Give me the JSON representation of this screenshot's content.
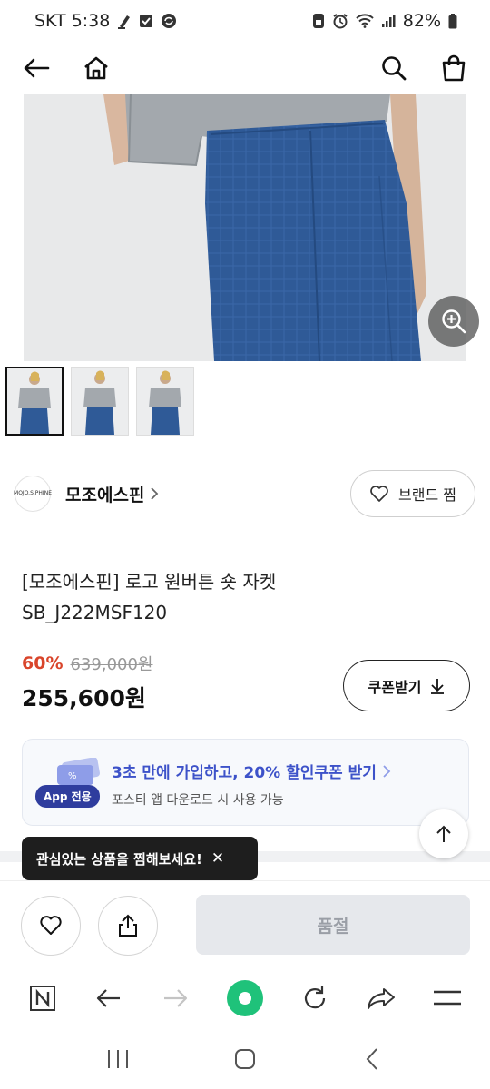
{
  "status_bar": {
    "carrier_time": "SKT 5:38",
    "battery": "82%"
  },
  "header": {
    "icons": [
      "back-arrow-icon",
      "home-icon",
      "search-icon",
      "shopping-bag-icon"
    ]
  },
  "gallery": {
    "thumbnail_count": 3,
    "active_index": 0
  },
  "brand": {
    "logo_text": "MOJO.S.PHINE",
    "name": "모조에스핀",
    "favorite_label": "브랜드 찜"
  },
  "product": {
    "title_line1": "[모조에스핀] 로고 원버튼 숏 자켓",
    "title_line2": "SB_J222MSF120"
  },
  "price": {
    "discount": "60%",
    "original": "639,000원",
    "sale": "255,600원",
    "coupon_label": "쿠폰받기"
  },
  "app_banner": {
    "badge": "App 전용",
    "title": "3초 만에 가입하고, 20% 할인쿠폰 받기",
    "subtitle": "포스티 앱 다운로드 시 사용 가능"
  },
  "tooltip": {
    "text": "관심있는 상품을 찜해보세요!"
  },
  "purchase_bar": {
    "soldout_label": "품절"
  },
  "colors": {
    "discount": "#d9452b",
    "banner_title": "#3d52c9",
    "app_badge": "#2f3d9e",
    "pants": "#2f5a97",
    "browser_home": "#1fc27a"
  }
}
